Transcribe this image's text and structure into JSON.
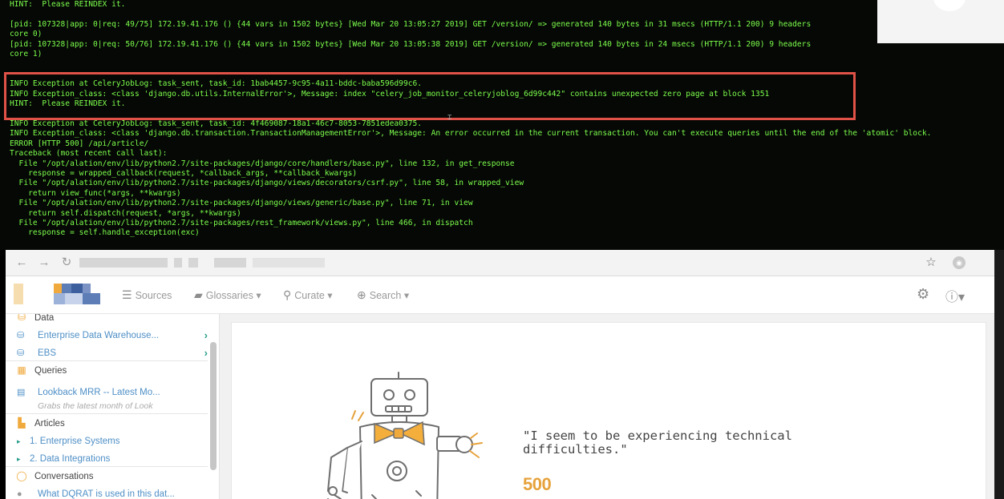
{
  "terminal": {
    "lines": [
      "HINT:  Please REINDEX it.",
      "",
      "[pid: 107328|app: 0|req: 49/75] 172.19.41.176 () {44 vars in 1502 bytes} [Wed Mar 20 13:05:27 2019] GET /version/ => generated 140 bytes in 31 msecs (HTTP/1.1 200) 9 headers",
      "core 0)",
      "[pid: 107328|app: 0|req: 50/76] 172.19.41.176 () {44 vars in 1502 bytes} [Wed Mar 20 13:05:38 2019] GET /version/ => generated 140 bytes in 24 msecs (HTTP/1.1 200) 9 headers",
      "core 1)",
      "",
      "",
      "INFO Exception at CeleryJobLog: task_sent, task_id: 1bab4457-9c95-4a11-bddc-baba596d99c6.",
      "INFO Exception_class: <class 'django.db.utils.InternalError'>, Message: index \"celery_job_monitor_celeryjoblog_6d99c442\" contains unexpected zero page at block 1351",
      "HINT:  Please REINDEX it.",
      "",
      "INFO Exception at CeleryJobLog: task_sent, task_id: 4f469087-18a1-46c7-8053-7851edea0375.",
      "INFO Exception_class: <class 'django.db.transaction.TransactionManagementError'>, Message: An error occurred in the current transaction. You can't execute queries until the end of the 'atomic' block.",
      "ERROR [HTTP 500] /api/article/",
      "Traceback (most recent call last):",
      "  File \"/opt/alation/env/lib/python2.7/site-packages/django/core/handlers/base.py\", line 132, in get_response",
      "    response = wrapped_callback(request, *callback_args, **callback_kwargs)",
      "  File \"/opt/alation/env/lib/python2.7/site-packages/django/views/decorators/csrf.py\", line 58, in wrapped_view",
      "    return view_func(*args, **kwargs)",
      "  File \"/opt/alation/env/lib/python2.7/site-packages/django/views/generic/base.py\", line 71, in view",
      "    return self.dispatch(request, *args, **kwargs)",
      "  File \"/opt/alation/env/lib/python2.7/site-packages/rest_framework/views.py\", line 466, in dispatch",
      "    response = self.handle_exception(exc)"
    ]
  },
  "browser": {
    "nav": {
      "sources": "Sources",
      "glossaries": "Glossaries",
      "curate": "Curate",
      "search": "Search"
    }
  },
  "sidebar": {
    "data_label": "Data",
    "data_items": [
      "Enterprise Data Warehouse...",
      "EBS"
    ],
    "queries_label": "Queries",
    "query_item": "Lookback MRR -- Latest Mo...",
    "query_desc": "Grabs the latest month of Look",
    "articles_label": "Articles",
    "article_items": [
      "1. Enterprise Systems",
      "2. Data Integrations"
    ],
    "conversations_label": "Conversations",
    "conversation_item": "What DQRAT is used in this dat..."
  },
  "error_page": {
    "message": "\"I seem to be experiencing technical\ndifficulties.\"",
    "code": "500"
  },
  "colors": {
    "terminal_text": "#7dff4c",
    "highlight_border": "#e05247",
    "link_blue": "#4e8fc6",
    "teal": "#2a9e8c",
    "error_orange": "#e6a23c"
  }
}
